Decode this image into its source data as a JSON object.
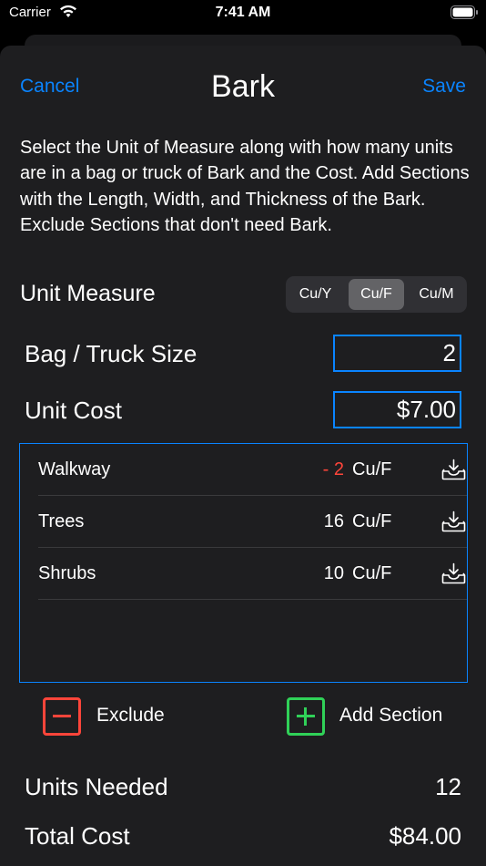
{
  "status_bar": {
    "carrier": "Carrier",
    "time": "7:41 AM"
  },
  "nav": {
    "cancel_label": "Cancel",
    "title": "Bark",
    "save_label": "Save"
  },
  "description": "Select the Unit of Measure along with how many units are in a bag or truck of Bark and the Cost. Add Sections with the Length, Width, and Thickness of the Bark. Exclude Sections that don't need  Bark.",
  "unit_measure": {
    "label": "Unit Measure",
    "options": [
      "Cu/Y",
      "Cu/F",
      "Cu/M"
    ],
    "selected": "Cu/F"
  },
  "bag_truck_size": {
    "label": "Bag / Truck Size",
    "value": "2"
  },
  "unit_cost": {
    "label": "Unit Cost",
    "value": "$7.00"
  },
  "sections": [
    {
      "name": "Walkway",
      "quantity": "- 2",
      "unit": "Cu/F",
      "excluded": true
    },
    {
      "name": "Trees",
      "quantity": "16",
      "unit": "Cu/F",
      "excluded": false
    },
    {
      "name": "Shrubs",
      "quantity": "10",
      "unit": "Cu/F",
      "excluded": false
    }
  ],
  "actions": {
    "exclude_label": "Exclude",
    "add_section_label": "Add Section"
  },
  "summary": {
    "units_needed_label": "Units Needed",
    "units_needed_value": "12",
    "total_cost_label": "Total Cost",
    "total_cost_value": "$84.00"
  },
  "colors": {
    "accent": "#0a84ff",
    "exclude": "#ff453a",
    "add": "#30d158",
    "sheet_background": "#1e1e20"
  },
  "icons": {
    "wifi": "wifi-icon",
    "battery": "battery-icon",
    "section_action": "tray-download-icon",
    "exclude": "minus-square-icon",
    "add": "plus-square-icon"
  }
}
